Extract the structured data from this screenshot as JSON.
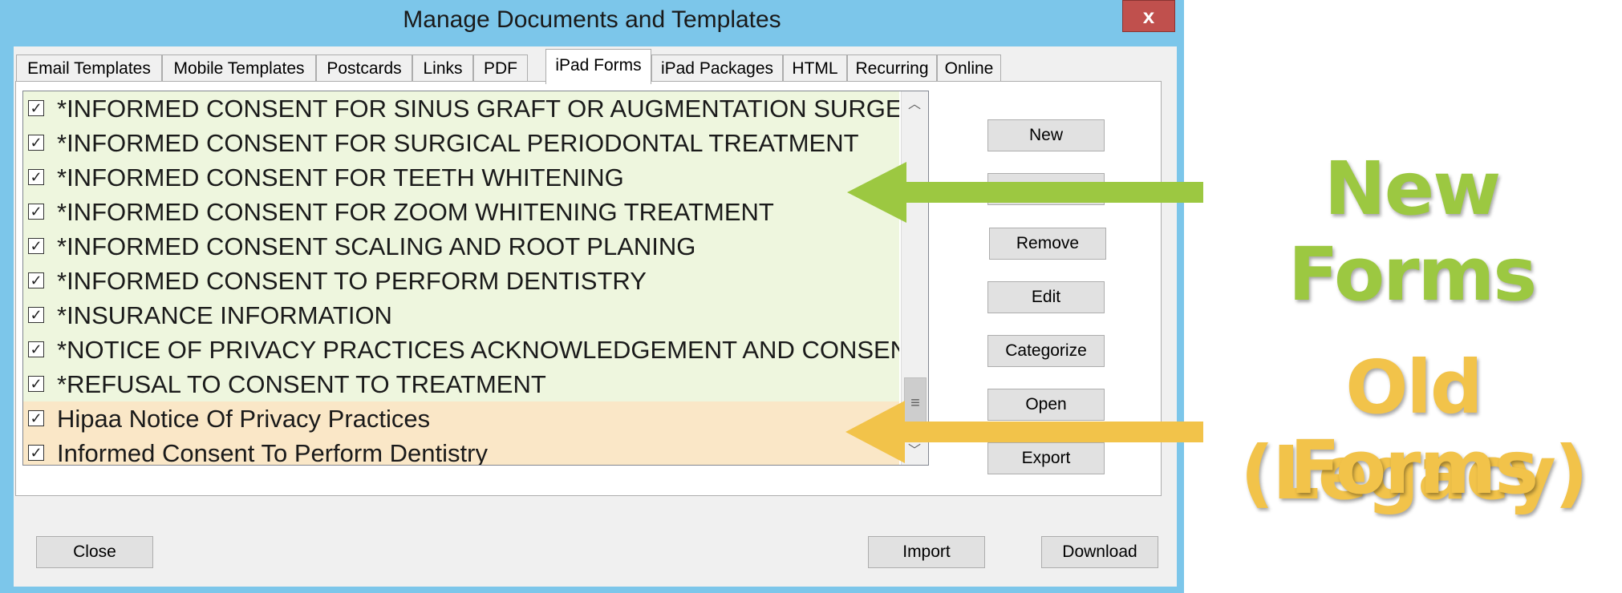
{
  "window": {
    "title": "Manage Documents and Templates",
    "close_label": "x"
  },
  "tabs": [
    {
      "label": "Email Templates",
      "active": false
    },
    {
      "label": "Mobile Templates",
      "active": false
    },
    {
      "label": "Postcards",
      "active": false
    },
    {
      "label": "Links",
      "active": false
    },
    {
      "label": "PDF",
      "active": false
    },
    {
      "label": "iPad Forms",
      "active": true
    },
    {
      "label": "iPad Packages",
      "active": false
    },
    {
      "label": "HTML",
      "active": false
    },
    {
      "label": "Recurring",
      "active": false
    },
    {
      "label": "Online",
      "active": false
    }
  ],
  "forms_list": {
    "items": [
      {
        "label": "*INFORMED CONSENT FOR SINUS GRAFT OR AUGMENTATION SURGERY",
        "checked": true,
        "group": "new"
      },
      {
        "label": "*INFORMED CONSENT FOR SURGICAL PERIODONTAL TREATMENT",
        "checked": true,
        "group": "new"
      },
      {
        "label": "*INFORMED CONSENT FOR TEETH WHITENING",
        "checked": true,
        "group": "new"
      },
      {
        "label": "*INFORMED CONSENT FOR ZOOM WHITENING TREATMENT",
        "checked": true,
        "group": "new"
      },
      {
        "label": "*INFORMED CONSENT SCALING AND ROOT PLANING",
        "checked": true,
        "group": "new"
      },
      {
        "label": "*INFORMED CONSENT TO PERFORM DENTISTRY",
        "checked": true,
        "group": "new"
      },
      {
        "label": "*INSURANCE INFORMATION",
        "checked": true,
        "group": "new"
      },
      {
        "label": "*NOTICE OF PRIVACY PRACTICES ACKNOWLEDGEMENT AND CONSENT",
        "checked": true,
        "group": "new"
      },
      {
        "label": "*REFUSAL TO CONSENT TO TREATMENT",
        "checked": true,
        "group": "new"
      },
      {
        "label": "Hipaa Notice Of Privacy Practices",
        "checked": true,
        "group": "old"
      },
      {
        "label": "Informed Consent To Perform Dentistry",
        "checked": true,
        "group": "old"
      }
    ]
  },
  "side_buttons": {
    "new": "New",
    "hidden": "",
    "remove": "Remove",
    "edit": "Edit",
    "categorize": "Categorize",
    "open": "Open",
    "export": "Export"
  },
  "footer": {
    "close": "Close",
    "import": "Import",
    "download": "Download"
  },
  "annotations": {
    "new_forms": "New Forms",
    "old_forms_line1": "Old (Legacy)",
    "old_forms_line2": "Forms"
  },
  "colors": {
    "titlebar": "#7cc6ea",
    "close_button": "#c0504d",
    "new_row_bg": "#eef6de",
    "old_row_bg": "#fae7c7",
    "new_arrow": "#9cc841",
    "old_arrow": "#f2c34a"
  }
}
